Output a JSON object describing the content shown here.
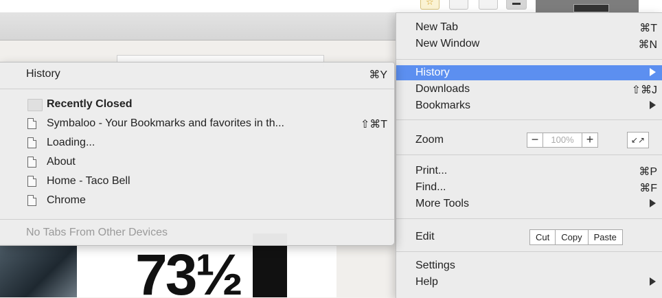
{
  "history_submenu": {
    "title": "History",
    "title_shortcut": "⌘Y",
    "section_header": "Recently Closed",
    "items": [
      {
        "label": "Symbaloo - Your Bookmarks and favorites in th...",
        "shortcut": "⇧⌘T"
      },
      {
        "label": "Loading...",
        "shortcut": ""
      },
      {
        "label": "About",
        "shortcut": ""
      },
      {
        "label": "Home - Taco Bell",
        "shortcut": ""
      },
      {
        "label": "Chrome",
        "shortcut": ""
      }
    ],
    "footer": "No Tabs From Other Devices"
  },
  "main_menu": {
    "new_tab": {
      "label": "New Tab",
      "shortcut": "⌘T"
    },
    "new_window": {
      "label": "New Window",
      "shortcut": "⌘N"
    },
    "history": {
      "label": "History"
    },
    "downloads": {
      "label": "Downloads",
      "shortcut": "⇧⌘J"
    },
    "bookmarks": {
      "label": "Bookmarks"
    },
    "zoom": {
      "label": "Zoom",
      "minus": "−",
      "value": "100%",
      "plus": "+",
      "fullscreen": "↙↗"
    },
    "print": {
      "label": "Print...",
      "shortcut": "⌘P"
    },
    "find": {
      "label": "Find...",
      "shortcut": "⌘F"
    },
    "more_tools": {
      "label": "More Tools"
    },
    "edit": {
      "label": "Edit",
      "cut": "Cut",
      "copy": "Copy",
      "paste": "Paste"
    },
    "settings": {
      "label": "Settings"
    },
    "help": {
      "label": "Help"
    }
  },
  "background": {
    "ad_text": "73½"
  },
  "colors": {
    "menu_bg": "#ececec",
    "highlight": "#5c8ff0",
    "disabled_text": "#9a9a9a"
  }
}
